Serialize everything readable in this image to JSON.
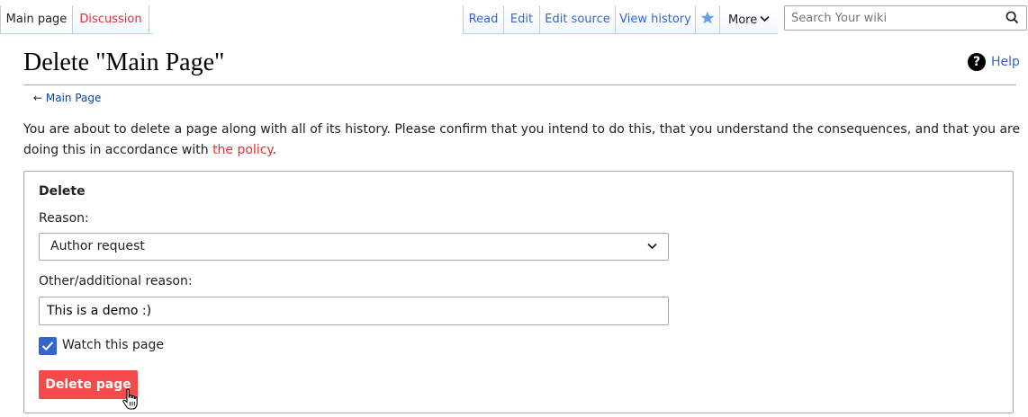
{
  "tabs_left": [
    {
      "label": "Main page",
      "selected": true
    },
    {
      "label": "Discussion",
      "selected": false,
      "redlink": true
    }
  ],
  "tabs_right": [
    "Read",
    "Edit",
    "Edit source",
    "View history"
  ],
  "watch_star_icon": "star-icon",
  "more": {
    "label": "More"
  },
  "search": {
    "placeholder": "Search Your wiki",
    "icon": "search-icon"
  },
  "page": {
    "title": "Delete \"Main Page\"",
    "help_label": "Help",
    "back_arrow": "←",
    "back_label": "Main Page",
    "intro_text": "You are about to delete a page along with all of its history. Please confirm that you intend to do this, that you understand the consequences, and that you are doing this in accordance with ",
    "intro_link": "the policy",
    "intro_end": "."
  },
  "form": {
    "legend": "Delete",
    "reason_label": "Reason:",
    "reason_value": "Author request",
    "other_label": "Other/additional reason:",
    "other_value": "This is a demo :)",
    "watch_label": "Watch this page",
    "watch_checked": true,
    "submit_label": "Delete page"
  },
  "colors": {
    "link": "#3366cc",
    "redlink": "#dd3333",
    "destructive": "#f44a4a",
    "checkbox": "#3366cc"
  }
}
